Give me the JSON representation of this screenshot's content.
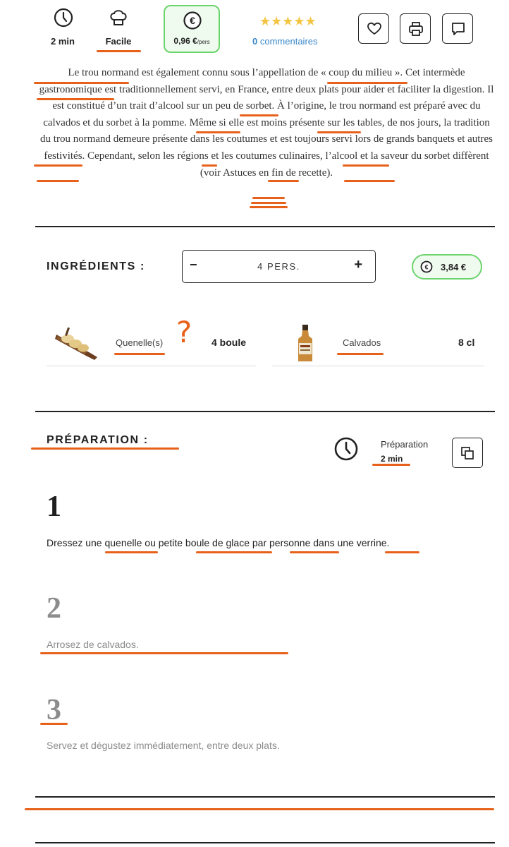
{
  "recipe_info": {
    "time": "2 min",
    "difficulty": "Facile",
    "cost_per_person_value": "0,96 €",
    "cost_per_person_unit": "/pers",
    "rating_stars": "★★★★★",
    "rating": 5,
    "comments_count": "0",
    "comments_label": "commentaires",
    "icons": [
      "clock-icon",
      "chef-hat-icon",
      "euro-icon",
      "heart-icon",
      "print-icon",
      "comment-icon"
    ]
  },
  "intro": {
    "text": "Le trou normand est également connu sous l’appellation de « coup du milieu ». Cet intermède gastronomique est traditionnellement servi, en France, entre deux plats pour aider et faciliter la digestion. Il est constitué d’un trait d’alcool sur un peu de sorbet. À l’origine, le trou normand est préparé avec du calvados et du sorbet à la pomme. Même si elle est moins présente sur les tables, de nos jours, la tradition du trou normand demeure présente dans les coutumes et est toujours servi lors de grands banquets et autres festivités. Cependant, selon les régions et les coutumes culinaires, l’alcool et la saveur du sorbet diffèrent (voir Astuces en fin de recette)."
  },
  "ingredients": {
    "title": "INGRÉDIENTS :",
    "persons": "4 PERS.",
    "minus": "−",
    "plus": "+",
    "total_cost": "3,84 €",
    "items": [
      {
        "name": "Quenelle(s)",
        "quantity": "4 boule",
        "annotation": "?"
      },
      {
        "name": "Calvados",
        "quantity": "8 cl"
      }
    ]
  },
  "preparation": {
    "title": "PRÉPARATION :",
    "time_label": "Préparation",
    "time_value": "2 min",
    "steps": [
      {
        "number": "1",
        "text": "Dressez une quenelle ou petite boule de glace par personne dans une verrine."
      },
      {
        "number": "2",
        "text": "Arrosez de calvados."
      },
      {
        "number": "3",
        "text": "Servez et dégustez immédiatement, entre deux plats."
      }
    ]
  },
  "colors": {
    "annotation_orange": "#e8611a",
    "cost_green": "#6cd46c",
    "link_blue": "#3a87c9",
    "star_gold": "#f4c542"
  }
}
